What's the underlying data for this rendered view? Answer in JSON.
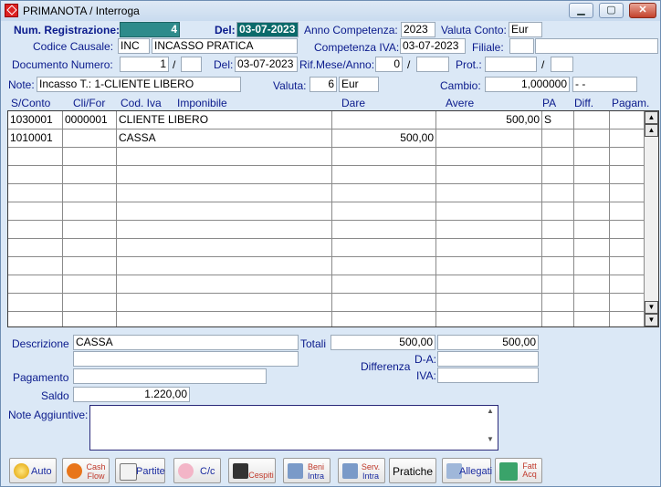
{
  "window": {
    "title": "PRIMANOTA / Interroga",
    "min": "▁",
    "max": "▢",
    "close": "✕"
  },
  "header": {
    "num_reg_label": "Num. Registrazione:",
    "num_reg_value": "4",
    "del_label": "Del:",
    "del_value": "03-07-2023",
    "anno_comp_label": "Anno Competenza:",
    "anno_comp_value": "2023",
    "valuta_conto_label": "Valuta Conto:",
    "valuta_conto_value": "Eur",
    "codice_causale_label": "Codice Causale:",
    "codice_causale_code": "INC",
    "codice_causale_desc": "INCASSO PRATICA",
    "comp_iva_label": "Competenza IVA:",
    "comp_iva_value": "03-07-2023",
    "filiale_label": "Filiale:",
    "filiale_value": "",
    "doc_num_label": "Documento Numero:",
    "doc_num_value": "1",
    "doc_num_sep": "/",
    "doc_num_suffix": "",
    "doc_del_label": "Del:",
    "doc_del_value": "03-07-2023",
    "rif_label": "Rif.Mese/Anno:",
    "rif_mese": "0",
    "rif_sep": "/",
    "rif_anno": "",
    "prot_label": "Prot.:",
    "prot_value": "",
    "prot_sep": "/",
    "prot_suffix": "",
    "note_label": "Note:",
    "note_value": "Incasso T.:  1-CLIENTE LIBERO",
    "valuta_label": "Valuta:",
    "valuta_code": "6",
    "valuta_name": "Eur",
    "cambio_label": "Cambio:",
    "cambio_value": "1,000000",
    "cambio_extra": "- -"
  },
  "grid": {
    "columns": [
      "S/Conto",
      "Cli/For",
      "Cod. Iva",
      "Imponibile",
      "Dare",
      "Avere",
      "PA",
      "Diff.",
      "Pagam."
    ],
    "rows": [
      {
        "sconto": "1030001",
        "clifor": "0000001",
        "codiva": "CLIENTE LIBERO",
        "dare": "",
        "avere": "500,00",
        "pa": "S",
        "diff": "",
        "pagam": ""
      },
      {
        "sconto": "1010001",
        "clifor": "",
        "codiva": "CASSA",
        "dare": "500,00",
        "avere": "",
        "pa": "",
        "diff": "",
        "pagam": ""
      }
    ]
  },
  "footer": {
    "descrizione_label": "Descrizione",
    "descrizione_value": "CASSA",
    "descrizione_value2": "",
    "totali_label": "Totali",
    "totali_dare": "500,00",
    "totali_avere": "500,00",
    "differenza_label": "Differenza",
    "da_label": "D-A:",
    "da_value": "",
    "iva_label": "IVA:",
    "iva_value": "",
    "pagamento_label": "Pagamento",
    "pagamento_value": "",
    "saldo_label": "Saldo",
    "saldo_value": "1.220,00",
    "note_agg_label": "Note Aggiuntive:",
    "note_agg_value": ""
  },
  "buttons": {
    "auto": "Auto",
    "cashflow_top": "Cash",
    "cashflow_bottom": "Flow",
    "partite": "Partite",
    "cc": "C/c",
    "cespiti": "Cespiti",
    "beni_top": "Beni",
    "beni_bottom": "Intra",
    "serv_top": "Serv.",
    "serv_bottom": "Intra",
    "pratiche": "Pratiche",
    "allegati": "Allegati",
    "fatt_top": "Fatt",
    "fatt_bottom": "Acq"
  },
  "icons": {
    "title": "home-icon",
    "scroll_up": "▲",
    "scroll_down": "▼"
  },
  "colors": {
    "teal_field": "#2e8b8b",
    "selected_field": "#0b6a6a",
    "window_bg": "#dbe8f6"
  }
}
